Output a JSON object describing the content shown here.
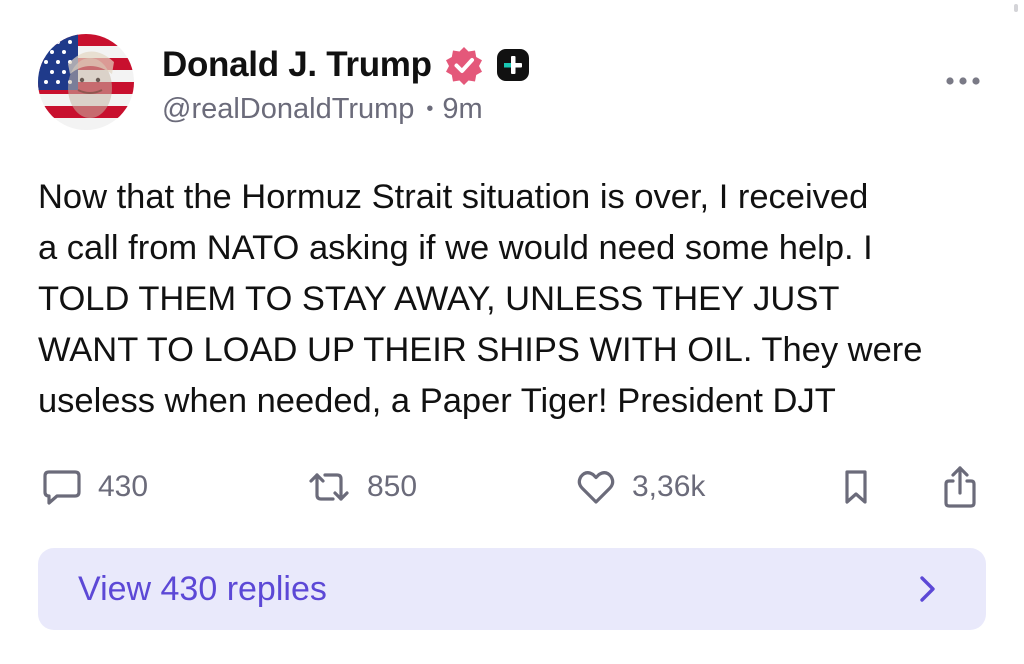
{
  "post": {
    "author": {
      "display_name": "Donald J. Trump",
      "handle": "@realDonaldTrump",
      "time": "9m",
      "separator": "•",
      "avatar": "avatar-flag-portrait",
      "verified_icon": "verified-badge-icon",
      "verified_color": "#e4587a",
      "plus_icon": "plus-badge-icon"
    },
    "text": "Now that the Hormuz Strait situation is over, I received\na call from NATO asking if we would need some help. I\nTOLD THEM TO STAY AWAY, UNLESS THEY JUST\nWANT TO LOAD UP THEIR SHIPS WITH OIL. They were\nuseless when needed, a Paper Tiger! President DJT",
    "actions": {
      "replies": {
        "icon": "comment-icon",
        "count": "430"
      },
      "reposts": {
        "icon": "repost-icon",
        "count": "850"
      },
      "likes": {
        "icon": "heart-icon",
        "count": "3,36k"
      },
      "bookmark": {
        "icon": "bookmark-icon"
      },
      "share": {
        "icon": "share-icon"
      }
    },
    "more_icon": "more-options-icon"
  },
  "replies_button": {
    "label": "View 430 replies",
    "icon": "chevron-right-icon",
    "background": "#e9e9fb",
    "text_color": "#5c48d6"
  }
}
